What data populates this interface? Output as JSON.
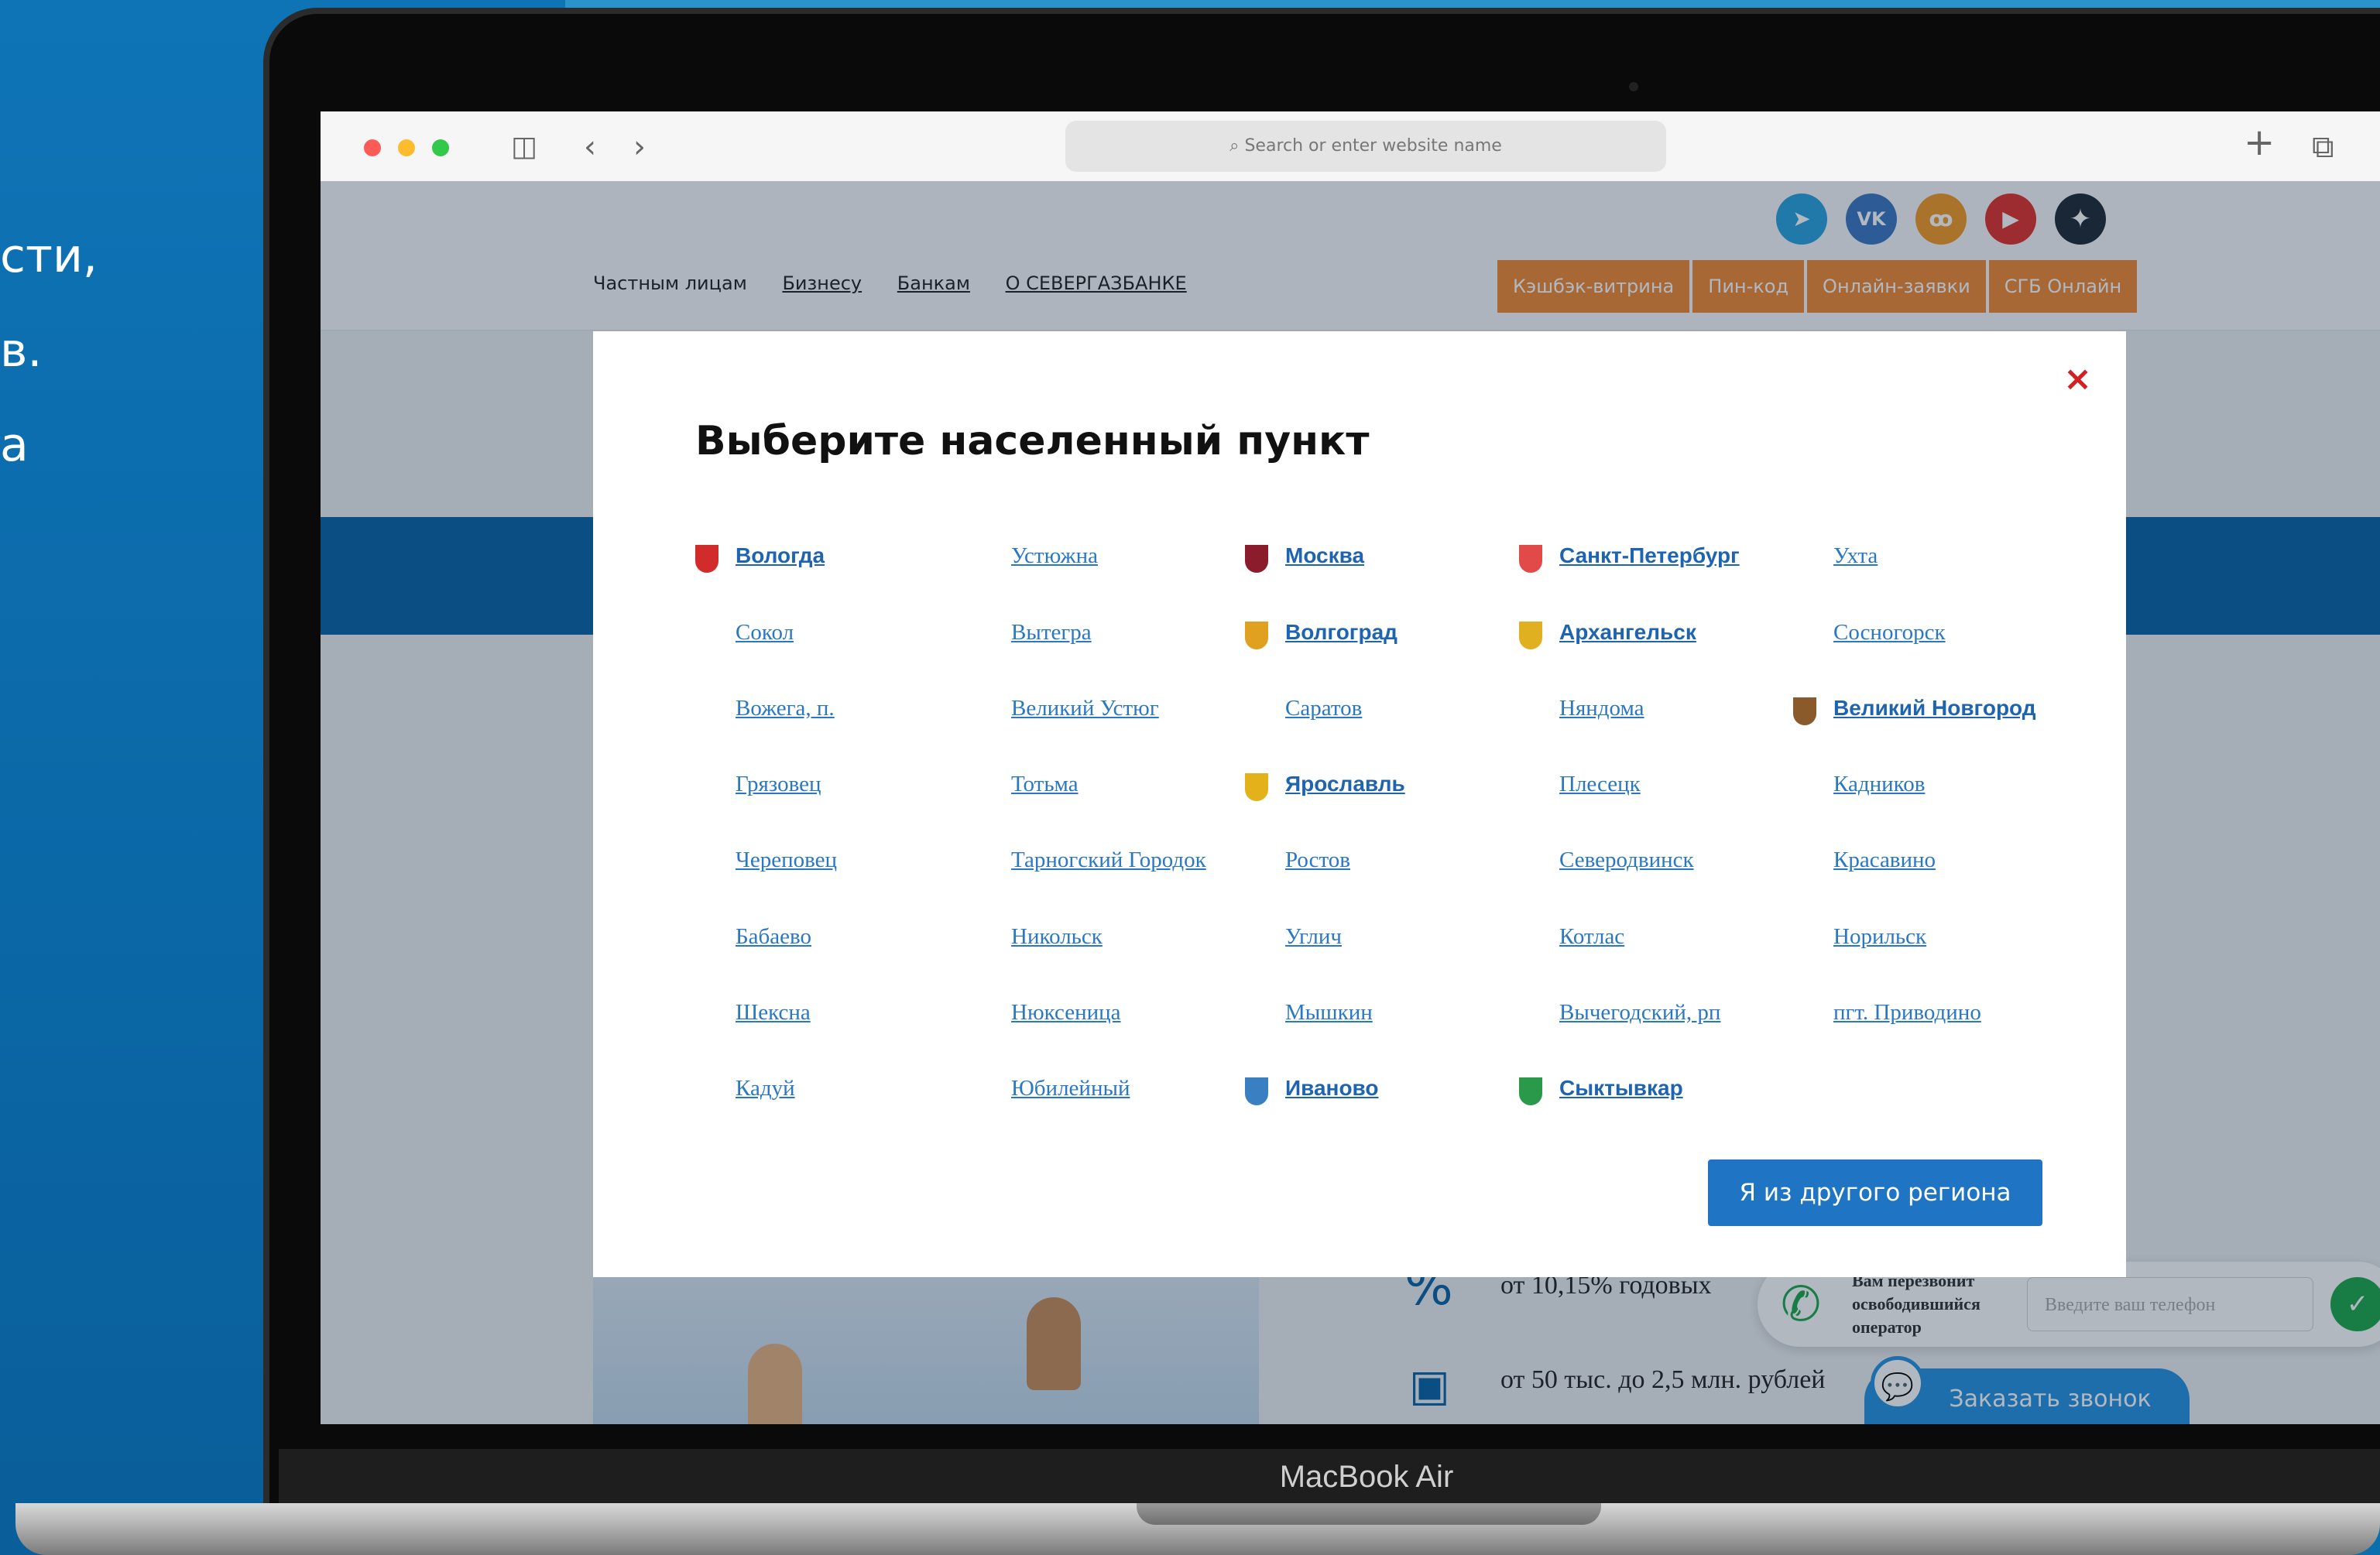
{
  "promo": {
    "lines": [
      "сти,",
      "в.",
      "а"
    ]
  },
  "browser": {
    "address_placeholder": "Search or enter website name",
    "icons": [
      "sidebar-icon",
      "back-icon",
      "forward-icon",
      "new-tab-icon",
      "tabs-overview-icon"
    ]
  },
  "site": {
    "social": [
      "telegram",
      "vk",
      "odnoklassniki",
      "youtube",
      "other"
    ],
    "nav": [
      "Частным лицам",
      "Бизнесу",
      "Банкам",
      "О СЕВЕРГАЗБАНКЕ"
    ],
    "actions": [
      "Кэшбэк-витрина",
      "Пин-код",
      "Онлайн-заявки",
      "СГБ Онлайн"
    ],
    "rate_text": "от 10,15% годовых",
    "amount_text": "от 50 тыс. до 2,5 млн. рублей",
    "callback": {
      "text": "Вам перезвонит освободившийся оператор",
      "placeholder": "Введите ваш телефон"
    },
    "order_call": "Заказать звонок"
  },
  "modal": {
    "title": "Выберите населенный пункт",
    "close": "×",
    "other_region": "Я из другого региона",
    "columns": [
      [
        "Вологда",
        "Сокол",
        "Вожега, п.",
        "Грязовец",
        "Череповец",
        "Бабаево",
        "Шексна",
        "Кадуй"
      ],
      [
        "Устюжна",
        "Вытегра",
        "Великий Устюг",
        "Тотьма",
        "Тарногский Городок",
        "Никольск",
        "Нюксеница",
        "Юбилейный"
      ],
      [
        "Москва",
        "Волгоград",
        "Саратов",
        "Ярославль",
        "Ростов",
        "Углич",
        "Мышкин",
        "Иваново"
      ],
      [
        "Санкт-Петербург",
        "Архангельск",
        "Няндома",
        "Плесецк",
        "Северодвинск",
        "Котлас",
        "Вычегодский, рп",
        "Сыктывкар"
      ],
      [
        "Ухта",
        "Сосногорск",
        "Великий Новгород",
        "Кадников",
        "Красавино",
        "Норильск",
        "пгт. Приводино"
      ]
    ]
  },
  "device": {
    "model": "MacBook Air"
  },
  "colors": {
    "accent_blue": "#1f74c3",
    "orange": "#f08a33",
    "close_red": "#d42020",
    "link": "#2a78c5"
  }
}
